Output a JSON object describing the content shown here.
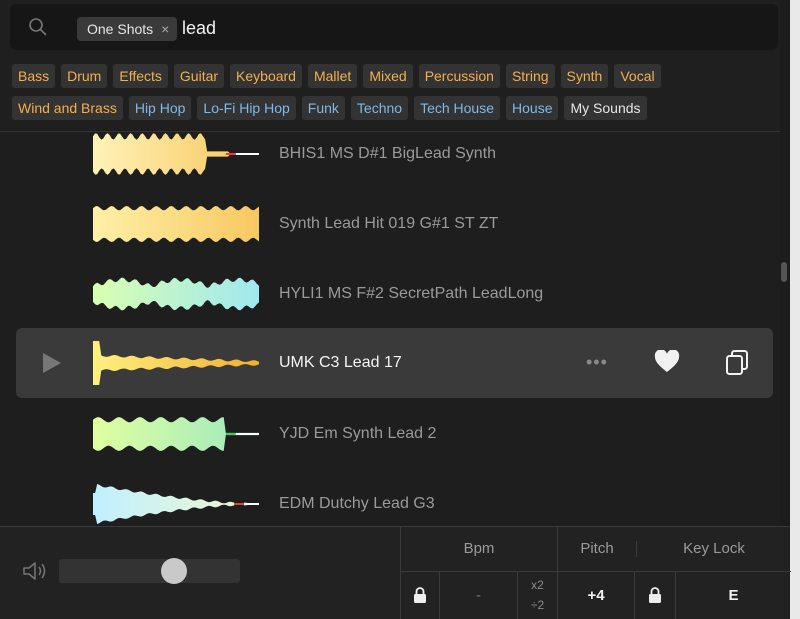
{
  "search": {
    "filter_chip": "One Shots",
    "chip_close": "×",
    "query": "lead"
  },
  "tags_row1": [
    {
      "label": "Bass",
      "color": "orange"
    },
    {
      "label": "Drum",
      "color": "orange"
    },
    {
      "label": "Effects",
      "color": "orange"
    },
    {
      "label": "Guitar",
      "color": "orange"
    },
    {
      "label": "Keyboard",
      "color": "orange"
    },
    {
      "label": "Mallet",
      "color": "orange"
    },
    {
      "label": "Mixed",
      "color": "orange"
    },
    {
      "label": "Percussion",
      "color": "orange"
    },
    {
      "label": "String",
      "color": "orange"
    },
    {
      "label": "Synth",
      "color": "orange"
    },
    {
      "label": "Vocal",
      "color": "orange"
    }
  ],
  "tags_row2": [
    {
      "label": "Wind and Brass",
      "color": "orange"
    },
    {
      "label": "Hip Hop",
      "color": "blue"
    },
    {
      "label": "Lo-Fi Hip Hop",
      "color": "blue"
    },
    {
      "label": "Funk",
      "color": "blue"
    },
    {
      "label": "Techno",
      "color": "blue"
    },
    {
      "label": "Tech House",
      "color": "blue"
    },
    {
      "label": "House",
      "color": "blue"
    },
    {
      "label": "My Sounds",
      "color": "white"
    }
  ],
  "sounds": [
    {
      "name": "BHIS1 MS D#1 BigLead Synth",
      "wave": "bhis"
    },
    {
      "name": "Synth Lead Hit 019 G#1 ST ZT",
      "wave": "hit"
    },
    {
      "name": "HYLI1 MS F#2 SecretPath LeadLong",
      "wave": "hyli"
    },
    {
      "name": "UMK C3 Lead 17",
      "wave": "umk",
      "active": true
    },
    {
      "name": "YJD Em Synth Lead 2",
      "wave": "yjd"
    },
    {
      "name": "EDM Dutchy Lead G3",
      "wave": "edm"
    }
  ],
  "row_actions": {
    "more": "•••"
  },
  "controls": {
    "bpm_label": "Bpm",
    "pitch_label": "Pitch",
    "keylock_label": "Key Lock",
    "bpm_value": "-",
    "mult_x2": "x2",
    "mult_div2": "÷2",
    "pitch_value": "+4",
    "key_value": "E"
  },
  "volume": {
    "level": 0.66
  },
  "colors": {
    "tag_orange": "#f2b04e",
    "tag_blue": "#7fb9e6",
    "active_row": "#3a3a3a"
  }
}
